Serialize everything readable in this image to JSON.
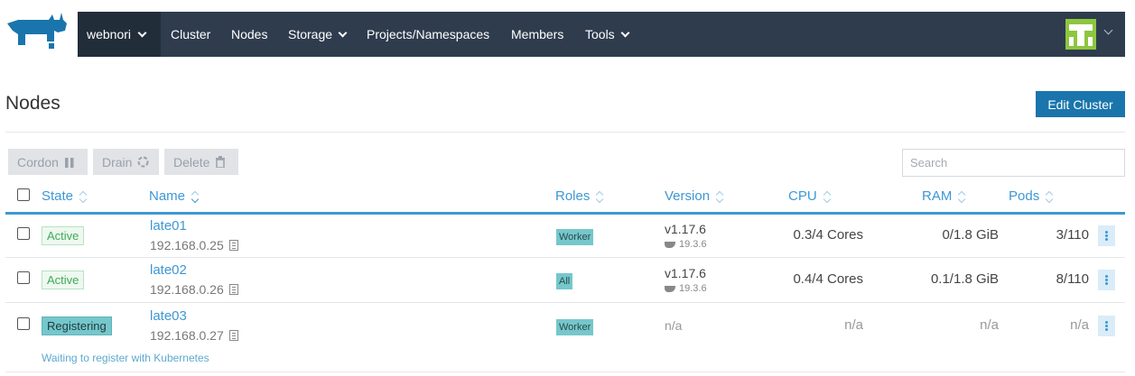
{
  "nav": {
    "cluster": "webnori",
    "items": [
      "Cluster",
      "Nodes",
      "Storage",
      "Projects/Namespaces",
      "Members",
      "Tools"
    ]
  },
  "page": {
    "title": "Nodes",
    "edit_button": "Edit Cluster"
  },
  "bulk_actions": {
    "cordon": "Cordon",
    "drain": "Drain",
    "delete": "Delete"
  },
  "search": {
    "placeholder": "Search"
  },
  "table": {
    "columns": [
      "State",
      "Name",
      "Roles",
      "Version",
      "CPU",
      "RAM",
      "Pods"
    ],
    "rows": [
      {
        "state": "Active",
        "name": "late01",
        "ip": "192.168.0.25",
        "role": "Worker",
        "version": "v1.17.6",
        "docker": "19.3.6",
        "cpu": "0.3/4 Cores",
        "ram": "0/1.8 GiB",
        "pods": "3/110"
      },
      {
        "state": "Active",
        "name": "late02",
        "ip": "192.168.0.26",
        "role": "All",
        "version": "v1.17.6",
        "docker": "19.3.6",
        "cpu": "0.4/4 Cores",
        "ram": "0.1/1.8 GiB",
        "pods": "8/110"
      },
      {
        "state": "Registering",
        "name": "late03",
        "ip": "192.168.0.27",
        "role": "Worker",
        "version": "n/a",
        "docker": "",
        "cpu": "n/a",
        "ram": "n/a",
        "pods": "n/a",
        "message": "Waiting to register with Kubernetes"
      }
    ]
  },
  "colors": {
    "nav_bg": "#2f3c4e",
    "accent": "#3d98d3",
    "primary_button": "#1a75ac",
    "active_badge": "#3dab55",
    "role_badge": "#75c7cc"
  }
}
